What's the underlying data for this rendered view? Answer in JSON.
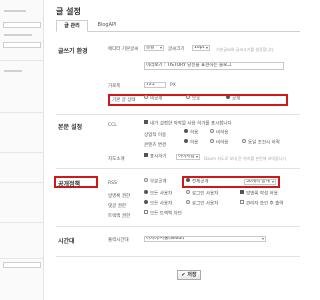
{
  "page": {
    "title": "글 설정"
  },
  "tabs": [
    {
      "label": "글 관리"
    },
    {
      "label": "BlogAPI"
    }
  ],
  "sections": {
    "writing": "글쓰기 환경",
    "display": "본문 설정",
    "publish": "공개정책",
    "time": "시간대"
  },
  "writing": {
    "font_label": "에디터 기본글씨",
    "font_face": "굴림",
    "font_size_label": "글씨크기",
    "font_size": "10pt",
    "font_hint": "기본글씨와 글씨크기를 설정합니다",
    "title_example": "미리보기 : TISTORY 당신을 표현하는 블로그",
    "width_label": "가로폭",
    "width_value": "725",
    "width_unit": "PX",
    "default_visibility_label": "기본 글 상태",
    "visibility_options": [
      "비공개",
      "보호",
      "공개"
    ]
  },
  "display": {
    "ccl_label": "CCL",
    "ccl_check": "내가 설정한 저작물 사용 허가를 표시합니다",
    "commercial_label": "상업적 이용",
    "commercial_opts": [
      "허용",
      "비허용"
    ],
    "modify_label": "콘텐츠 변경",
    "modify_opts": [
      "허용",
      "비허용",
      "동일 조건시 허락"
    ],
    "map_label": "지도소개",
    "map_check": "표시하기",
    "map_select": "이미지맵",
    "map_hint": "Daum 지도로 보내 준 위치를 본문에 보여줍니다"
  },
  "publish": {
    "rss_label": "RSS",
    "rss_opts": [
      "부분공개",
      "전체공개"
    ],
    "rss_count": "50개씩 공개",
    "guestbook_label": "방명록 권한",
    "guestbook_opts": [
      "모든 사용자",
      "로그인 사용자"
    ],
    "guestbook_check": "방명록 작성 허용",
    "comment_label": "댓글 권한",
    "comment_opts": [
      "모든 사용자",
      "로그인 사용자"
    ],
    "comment_check": "관리자 승인 후 출력",
    "trackback_label": "트랙백 권한",
    "trackback_check": "모든 트랙백 차단"
  },
  "time": {
    "label": "출력시간대",
    "value": "아시아/서울(Seoul)"
  },
  "sidebar": {
    "items": [
      "",
      "",
      ""
    ]
  },
  "actions": {
    "save": "✔ 저장"
  }
}
